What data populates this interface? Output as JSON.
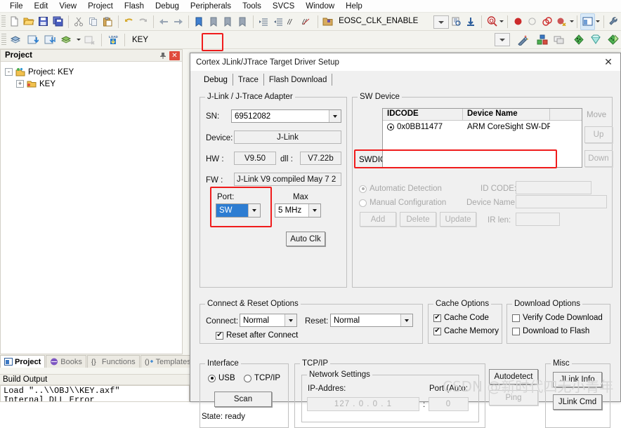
{
  "menu": {
    "items": [
      "File",
      "Edit",
      "View",
      "Project",
      "Flash",
      "Debug",
      "Peripherals",
      "Tools",
      "SVCS",
      "Window",
      "Help"
    ]
  },
  "toolbar_main": {
    "icons": [
      "new-file-icon",
      "open-file-icon",
      "save-icon",
      "save-all-icon",
      "cut-icon",
      "copy-icon",
      "paste-icon",
      "undo-icon",
      "redo-icon",
      "navigate-back-icon",
      "navigate-forward-icon",
      "bookmark-toggle-icon",
      "bookmark-prev-icon",
      "bookmark-next-icon",
      "bookmark-clear-icon",
      "indent-icon",
      "outdent-icon",
      "comment-icon",
      "uncomment-icon"
    ],
    "symbol_value": "EOSC_CLK_ENABLE",
    "symbol_placeholder": "",
    "right_icons": [
      "insert-file-icon",
      "find-in-files-icon",
      "goto-definition-icon",
      "zoom-search-icon",
      "breakpoint-icon",
      "breakpoint-disabled-icon",
      "breakpoint-kill-all-icon",
      "breakpoint-disable-all-icon",
      "window-layout-icon",
      "configure-tools-icon"
    ]
  },
  "toolbar_build": {
    "icons": [
      "translate-icon",
      "build-icon",
      "rebuild-icon",
      "batch-build-icon",
      "stop-build-icon",
      "load-icon"
    ],
    "target_value": "KEY",
    "highlighted_icon": "options-for-target-icon",
    "right_icons": [
      "options-for-target-icon",
      "manage-project-items-icon",
      "multi-project-icon",
      "configuration-wizard-icon",
      "pack-installer-icon",
      "manage-run-time-env-icon"
    ]
  },
  "project_panel": {
    "title": "Project",
    "pin_icon": "pin-icon",
    "close_icon": "close-icon",
    "tree": [
      {
        "label": "Project: KEY",
        "expander": "-",
        "icon": "project-icon",
        "indent": 0
      },
      {
        "label": "KEY",
        "expander": "+",
        "icon": "target-folder-icon",
        "indent": 16
      }
    ]
  },
  "bottom_tabs": [
    {
      "label": "Project",
      "icon": "project-tab-icon",
      "active": true
    },
    {
      "label": "Books",
      "icon": "books-icon",
      "active": false
    },
    {
      "label": "Functions",
      "icon": "functions-icon",
      "active": false
    },
    {
      "label": "Templates",
      "icon": "templates-icon",
      "active": false
    }
  ],
  "build_output": {
    "title": "Build Output",
    "lines": [
      "Load \"..\\\\OBJ\\\\KEY.axf\"",
      "Internal DLL Error"
    ]
  },
  "dialog": {
    "title": "Cortex JLink/JTrace Target Driver Setup",
    "close_label": "✕",
    "tabs": [
      {
        "label": "Debug",
        "active": true
      },
      {
        "label": "Trace",
        "active": false
      },
      {
        "label": "Flash Download",
        "active": false
      }
    ],
    "adapter": {
      "legend": "J-Link / J-Trace Adapter",
      "sn_label": "SN:",
      "sn_value": "69512082",
      "device_label": "Device:",
      "device_value": "J-Link",
      "hw_label": "HW :",
      "hw_value": "V9.50",
      "dll_label": "dll :",
      "dll_value": "V7.22b",
      "fw_label": "FW :",
      "fw_value": "J-Link V9 compiled May  7 2",
      "port_label": "Port:",
      "port_value": "SW",
      "max_label": "Max",
      "max_value": "5 MHz",
      "auto_clk_label": "Auto Clk"
    },
    "sw_device": {
      "legend": "SW Device",
      "columns": [
        "IDCODE",
        "Device Name",
        ""
      ],
      "rows": [
        {
          "pin": "SWDIO",
          "idcode": "0x0BB11477",
          "device_name": "ARM CoreSight SW-DP"
        }
      ],
      "move_label": "Move",
      "up_label": "Up",
      "down_label": "Down",
      "automatic_detection_label": "Automatic Detection",
      "manual_configuration_label": "Manual Configuration",
      "id_code_label": "ID CODE:",
      "id_code_value": "",
      "device_name_label": "Device Name:",
      "device_name_value": "",
      "ir_len_label": "IR len:",
      "ir_len_value": "",
      "add_label": "Add",
      "delete_label": "Delete",
      "update_label": "Update"
    },
    "connect_reset": {
      "legend": "Connect & Reset Options",
      "connect_label": "Connect:",
      "connect_value": "Normal",
      "reset_label": "Reset:",
      "reset_value": "Normal",
      "reset_after_connect_label": "Reset after Connect",
      "reset_after_connect_checked": "✔"
    },
    "cache_options": {
      "legend": "Cache Options",
      "cache_code_label": "Cache Code",
      "cache_code_checked": "✔",
      "cache_memory_label": "Cache Memory",
      "cache_memory_checked": "✔"
    },
    "download_options": {
      "legend": "Download Options",
      "verify_code_label": "Verify Code Download",
      "download_flash_label": "Download to Flash"
    },
    "interface": {
      "legend": "Interface",
      "usb_label": "USB",
      "tcpip_label": "TCP/IP",
      "scan_label": "Scan",
      "state_label": "State: ready"
    },
    "tcpip": {
      "legend": "TCP/IP",
      "network_legend": "Network Settings",
      "ip_label": "IP-Addres:",
      "ip_value": "127  .  0  .  0  .  1",
      "colon": ":",
      "port_label": "Port (Auto:",
      "port_value": "0",
      "autodetect_label": "Autodetect",
      "ping_label": "Ping"
    },
    "misc": {
      "legend": "Misc",
      "jlink_info_label": "JLink Info",
      "jlink_cmd_label": "JLink Cmd"
    }
  },
  "watermark": {
    "text": "CSDN @新时代四无小青年"
  },
  "colors": {
    "annotation_red": "#f01c1c",
    "selection_blue": "#2d7dd2",
    "panel_close_red": "#e04b3c"
  }
}
